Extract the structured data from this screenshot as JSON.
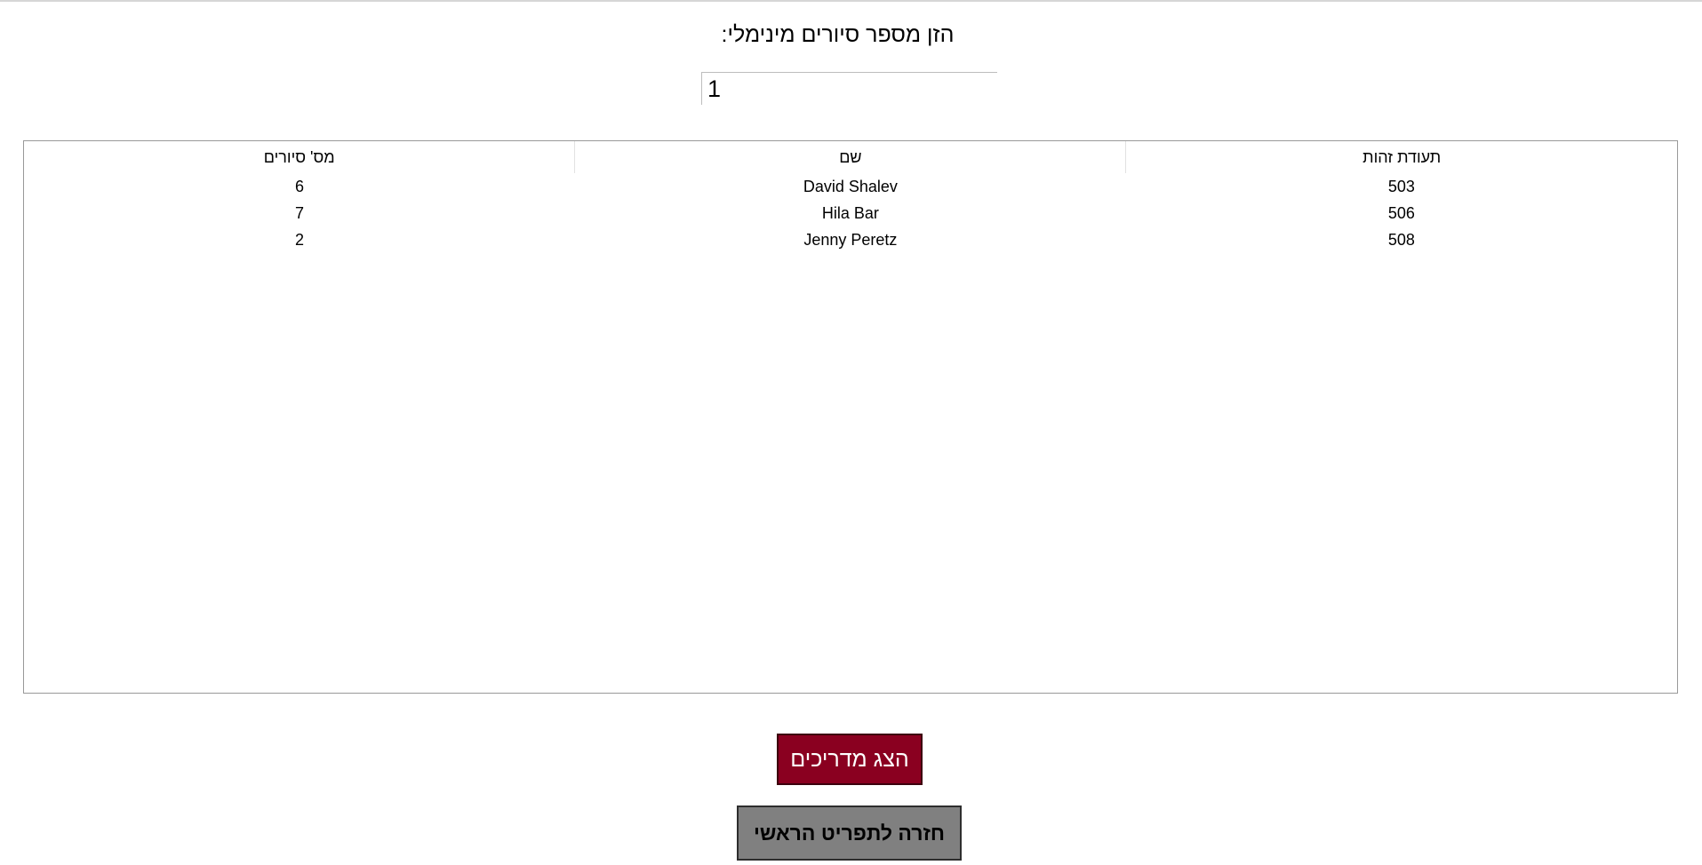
{
  "prompt": {
    "label": ":הזן מספר סיורים מינימלי"
  },
  "min_tours_input": {
    "value": "1"
  },
  "table": {
    "columns": [
      "מס' סיורים",
      "שם",
      "תעודת זהות"
    ],
    "rows": [
      {
        "tours": "6",
        "name": "David Shalev",
        "id": "503"
      },
      {
        "tours": "7",
        "name": "Hila Bar",
        "id": "506"
      },
      {
        "tours": "2",
        "name": "Jenny Peretz",
        "id": "508"
      }
    ]
  },
  "buttons": {
    "show_guides": "הצג מדריכים",
    "back_to_main": "חזרה לתפריט הראשי"
  },
  "colors": {
    "show_button_bg": "#8a0020",
    "back_button_bg": "#808080"
  }
}
